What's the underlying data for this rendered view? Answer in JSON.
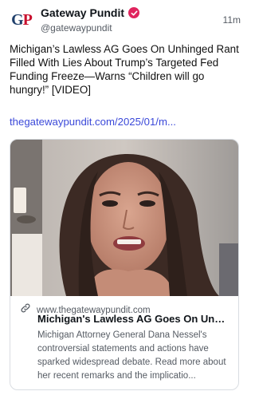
{
  "post": {
    "author": {
      "name": "Gateway Pundit",
      "handle": "@gatewaypundit",
      "avatar_icon": "gp-logo-icon",
      "verified_icon": "verified-badge-icon",
      "verified_color": "#e0245e"
    },
    "time": "11m",
    "text": "Michigan’s Lawless AG Goes On Unhinged Rant Filled With Lies About Trump’s Targeted Fed Funding Freeze—Warns “Children will go hungry!” [VIDEO]",
    "link": "thegatewaypundit.com/2025/01/m...",
    "link_color": "#3b49d9"
  },
  "card": {
    "domain": "www.thegatewaypundit.com",
    "domain_icon": "link-icon",
    "title": "Michigan's Lawless AG Goes On Unhi...",
    "description": "Michigan Attorney General Dana Nessel's controversial statements and actions have sparked widespread debate. Read more about her recent remarks and the implicatio..."
  }
}
